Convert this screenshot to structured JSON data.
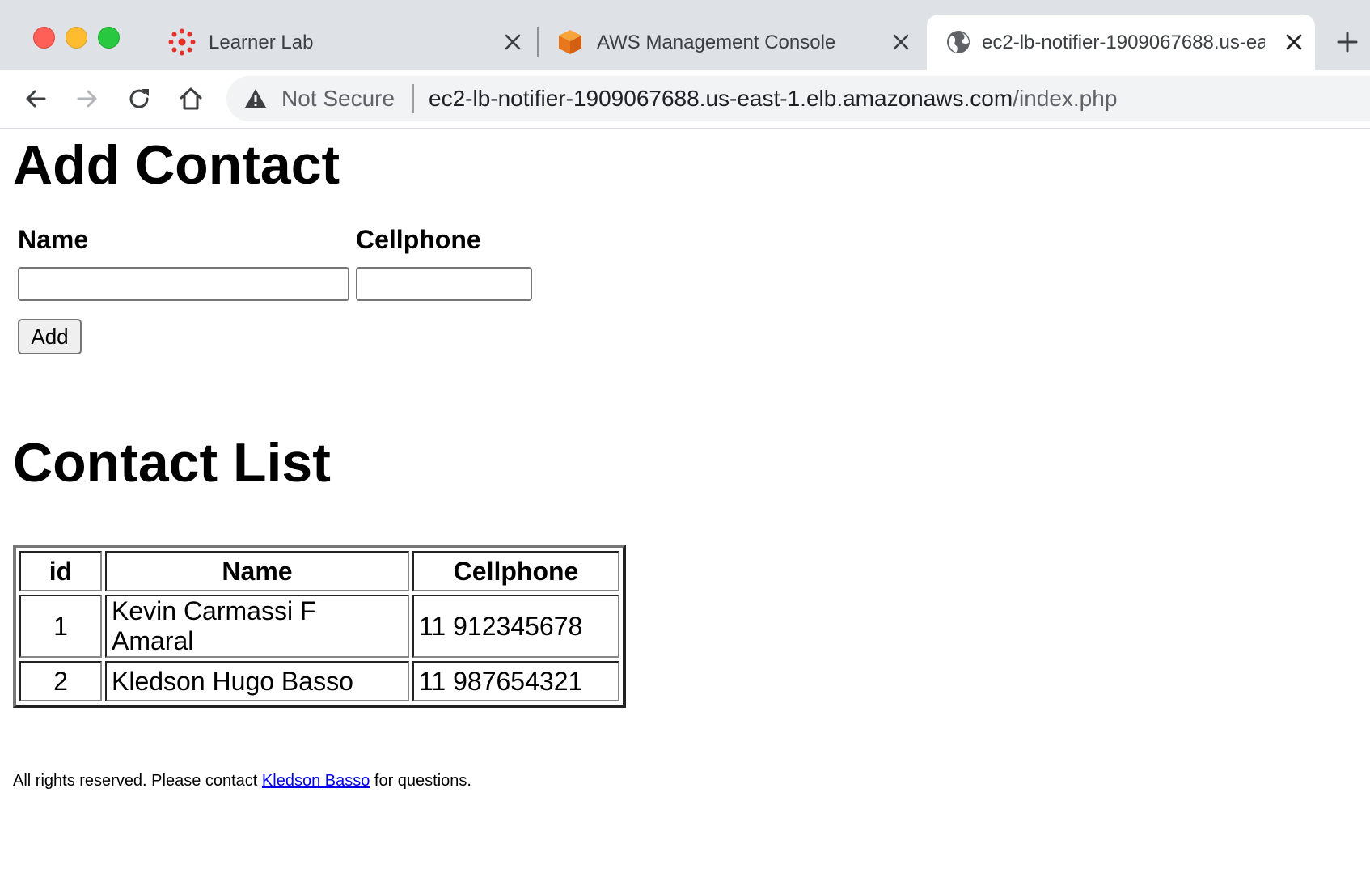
{
  "browser": {
    "tabs": [
      {
        "title": "Learner Lab"
      },
      {
        "title": "AWS Management Console"
      },
      {
        "title": "ec2-lb-notifier-1909067688.us-east-1.elb.amazonaws.com"
      }
    ],
    "omnibox": {
      "security_label": "Not Secure",
      "url_host": "ec2-lb-notifier-1909067688.us-east-1.elb.amazonaws.com",
      "url_path": "/index.php"
    }
  },
  "form": {
    "heading": "Add Contact",
    "name_label": "Name",
    "cellphone_label": "Cellphone",
    "name_value": "",
    "cellphone_value": "",
    "submit_label": "Add"
  },
  "list": {
    "heading": "Contact List",
    "columns": [
      "id",
      "Name",
      "Cellphone"
    ],
    "rows": [
      {
        "id": "1",
        "name": "Kevin Carmassi F Amaral",
        "cellphone": "11 912345678"
      },
      {
        "id": "2",
        "name": "Kledson Hugo Basso",
        "cellphone": "11 987654321"
      }
    ]
  },
  "footer": {
    "prefix": "All rights reserved. Please contact ",
    "link_text": "Kledson Basso",
    "suffix": " for questions."
  },
  "colors": {
    "tab_bar": "#dee1e6",
    "link": "#0000ee",
    "aws_orange": "#f08a24",
    "canvas_red": "#e4322b"
  },
  "icons": {
    "tab1_favicon": "canvas-logo-icon",
    "tab2_favicon": "aws-cube-icon",
    "tab3_favicon": "globe-icon",
    "security": "warning-triangle-icon"
  }
}
